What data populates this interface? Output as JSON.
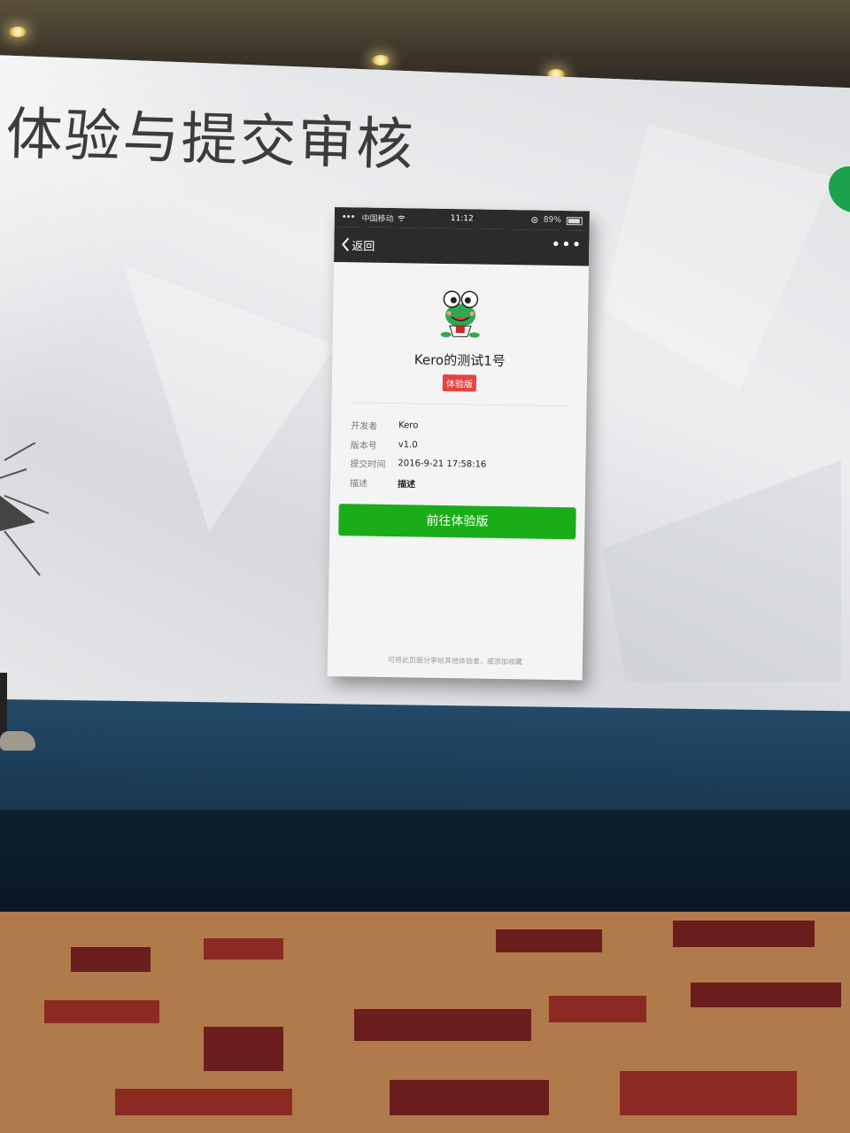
{
  "slide": {
    "title": "体验与提交审核"
  },
  "phone": {
    "status_bar": {
      "carrier": "中国移动",
      "time": "11:12",
      "battery": "89%"
    },
    "nav": {
      "back_label": "返回",
      "more_label": "•••"
    },
    "app": {
      "name": "Kero的测试1号",
      "badge": "体验版",
      "icon": "frog-mascot-icon"
    },
    "info": [
      {
        "label": "开发者",
        "value": "Kero"
      },
      {
        "label": "版本号",
        "value": "v1.0"
      },
      {
        "label": "提交时间",
        "value": "2016-9-21 17:58:16"
      },
      {
        "label": "描述",
        "value": "描述"
      }
    ],
    "primary_button": "前往体验版",
    "footer_note": "可将此页面分享给其他体验者，或添加收藏"
  },
  "colors": {
    "primary_green": "#1aad19",
    "badge_red": "#e64340",
    "nav_dark": "#2b2b2b"
  }
}
